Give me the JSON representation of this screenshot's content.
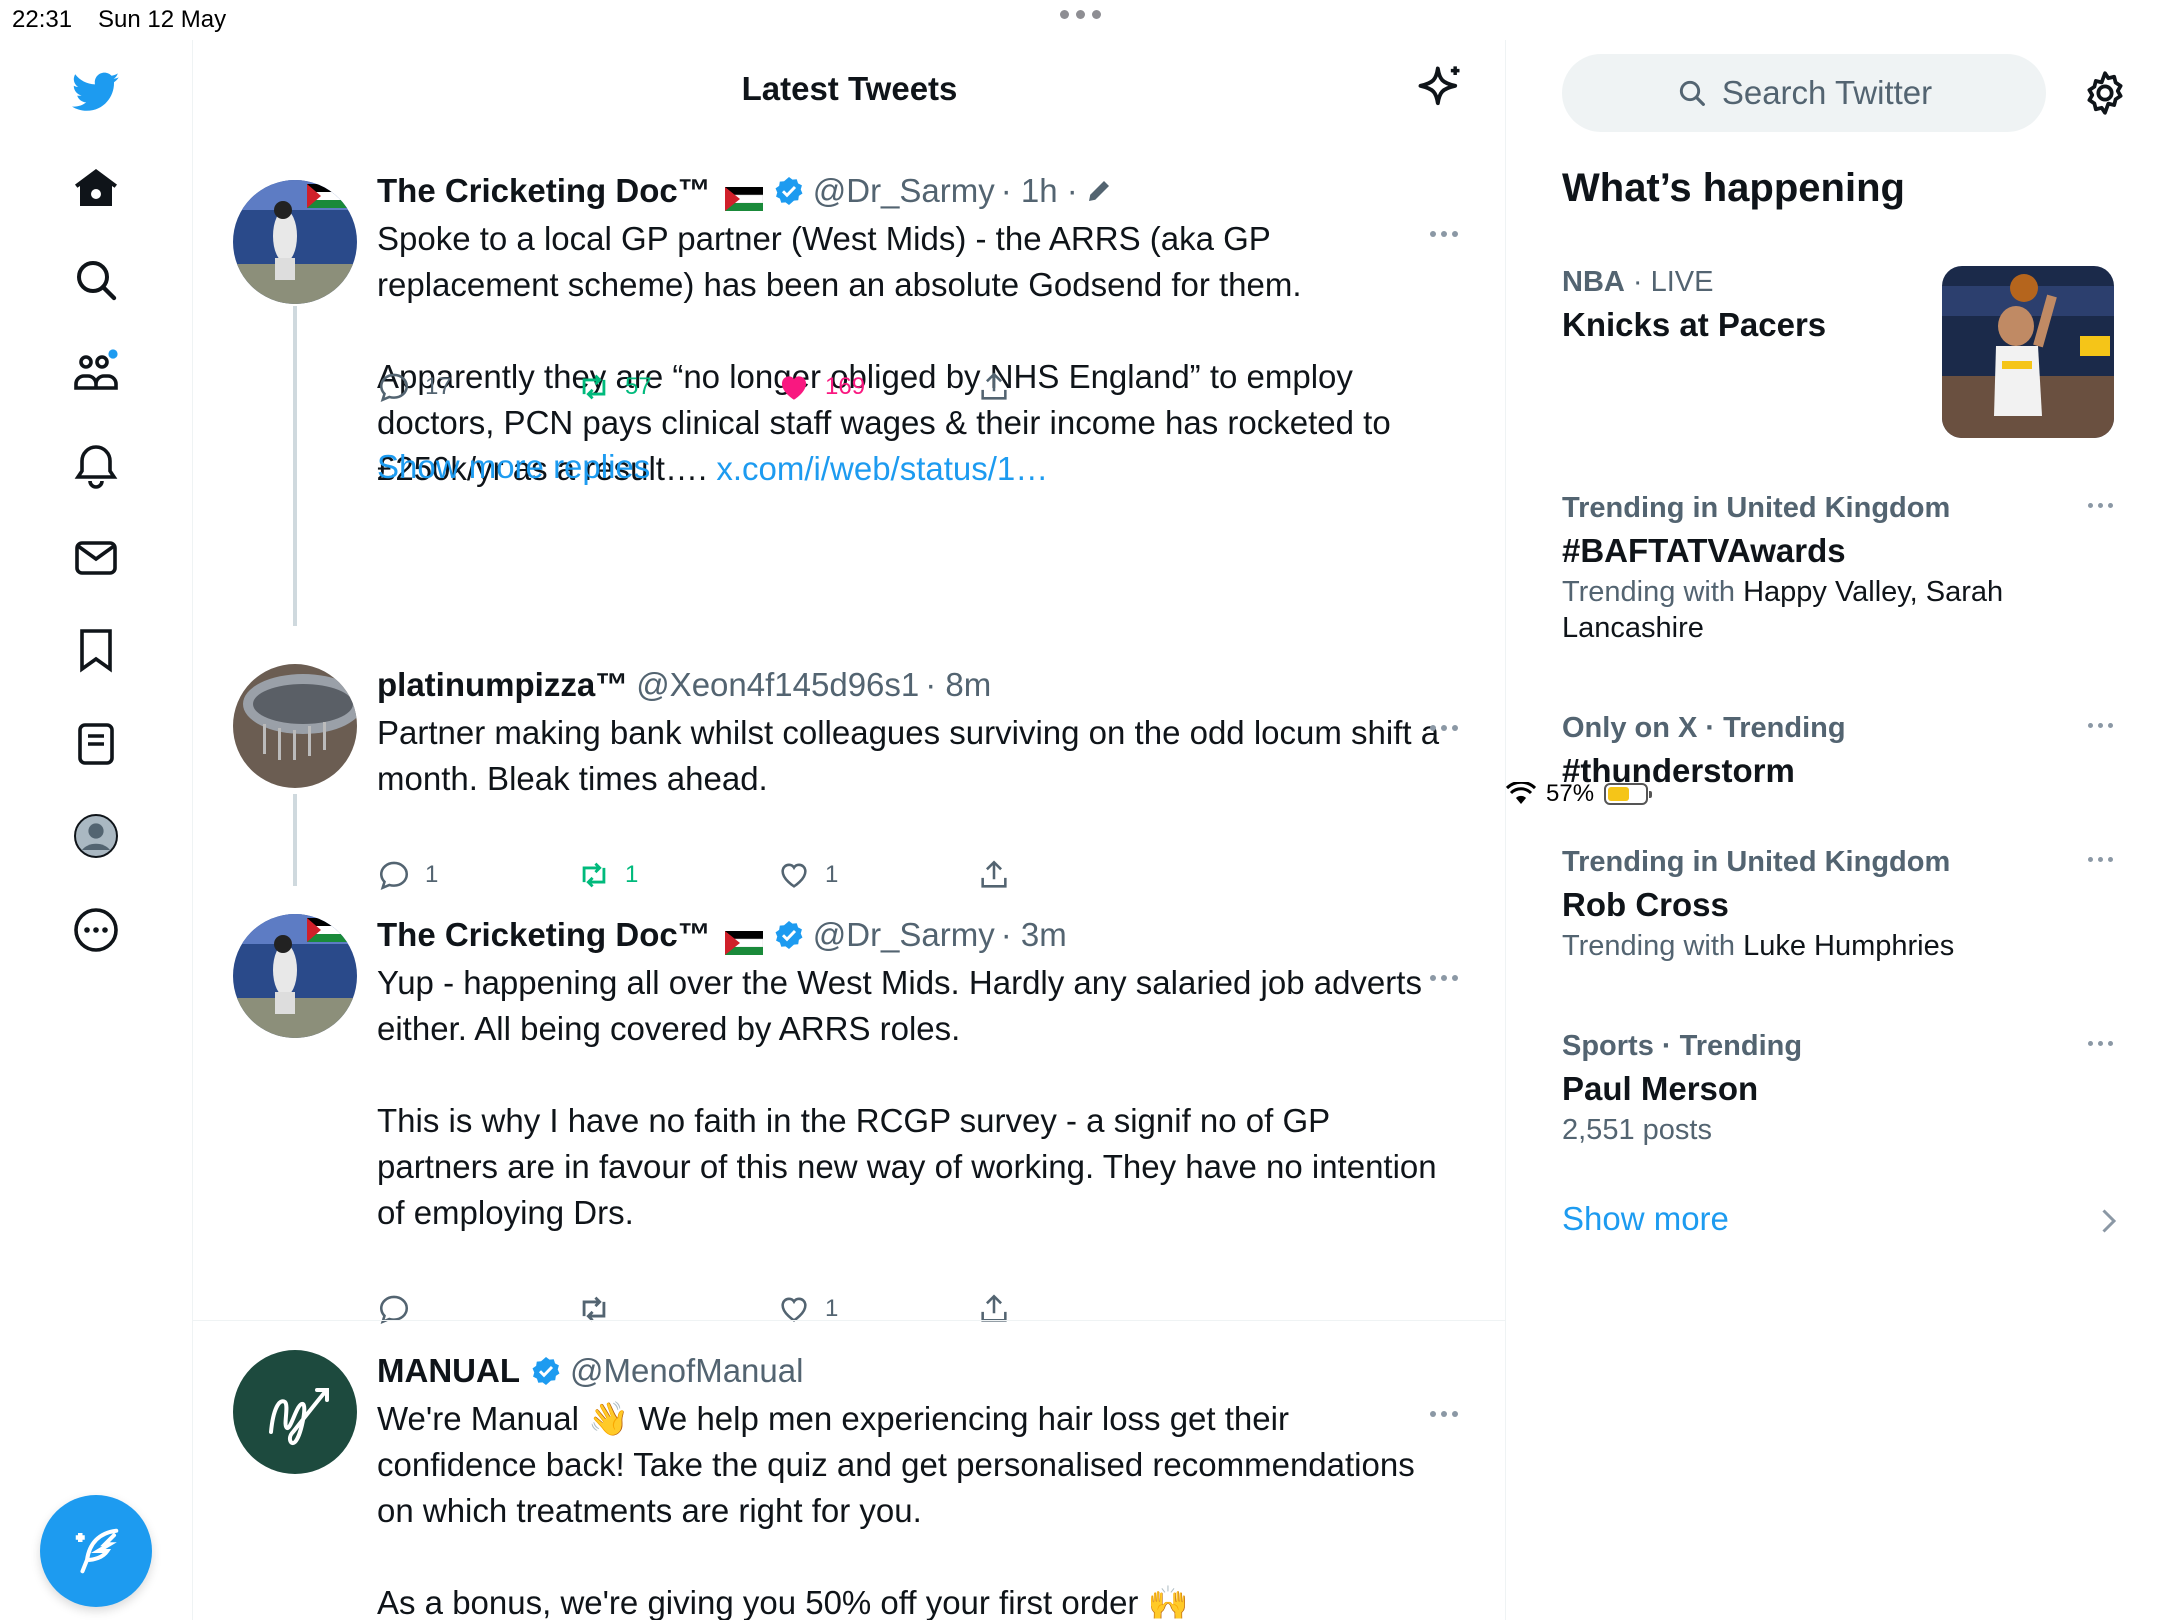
{
  "status_bar": {
    "time": "22:31",
    "date": "Sun 12 May",
    "battery": "57%",
    "battery_level": 0.57
  },
  "nav": {
    "icons": [
      "twitter-logo-icon",
      "home-icon",
      "search-icon",
      "communities-icon",
      "notifications-icon",
      "messages-icon",
      "bookmarks-icon",
      "lists-icon",
      "profile-icon",
      "more-icon"
    ],
    "compose_icon": "compose-tweet-icon"
  },
  "main": {
    "title": "Latest Tweets",
    "tweets": [
      {
        "name": "The Cricketing Doc™",
        "handle": "@Dr_Sarmy",
        "time": "· 1h ·",
        "text": "Spoke to a local GP partner (West Mids) - the ARRS (aka GP replacement scheme) has been an absolute Godsend for them.\n\nApparently they are “no longer obliged by NHS England” to employ doctors, PCN pays clinical staff wages & their income has rocketed to £250k/yr as a result…. ",
        "link": "x.com/i/web/status/1…",
        "replies": "17",
        "retweets": "57",
        "likes": "169"
      },
      {
        "name": "platinumpizza™",
        "handle": "@Xeon4f145d96s1",
        "time": "· 8m",
        "text": "Partner making bank whilst colleagues surviving on the odd locum shift a month. Bleak times ahead.",
        "replies": "1",
        "retweets": "1",
        "likes": "1"
      },
      {
        "name": "The Cricketing Doc™",
        "handle": "@Dr_Sarmy",
        "time": "· 3m",
        "text": "Yup - happening all over the West Mids. Hardly any salaried job adverts either. All being covered by ARRS roles.\n\nThis is why I have no faith in the RCGP survey - a signif no of GP partners are in favour of this new way of working. They have no intention of employing Drs.",
        "replies": "",
        "retweets": "",
        "likes": "1"
      },
      {
        "name": "MANUAL",
        "handle": "@MenofManual",
        "time": "",
        "text": "We're Manual 👋 We help men experiencing hair loss get their confidence back! Take the quiz and get personalised recommendations on which treatments are right for you.\n\nAs a bonus, we're giving you 50% off your first order 🙌"
      }
    ],
    "show_more_replies": "Show more replies"
  },
  "sidebar": {
    "search_placeholder": "Search Twitter",
    "happening_title": "What’s happening",
    "trends": [
      {
        "meta_bold": "NBA",
        "meta_rest": " · LIVE",
        "title": "Knicks at Pacers",
        "sub_label": "",
        "sub_value": ""
      },
      {
        "meta_bold": "Trending in United Kingdom",
        "meta_rest": "",
        "title": "#BAFTATVAwards",
        "sub_label": "Trending with ",
        "sub_value": "Happy Valley, Sarah Lancashire"
      },
      {
        "meta_bold": "Only on X · Trending",
        "meta_rest": "",
        "title": "#thunderstorm",
        "sub_label": "",
        "sub_value": ""
      },
      {
        "meta_bold": "Trending in United Kingdom",
        "meta_rest": "",
        "title": "Rob Cross",
        "sub_label": "Trending with ",
        "sub_value": "Luke Humphries"
      },
      {
        "meta_bold": "Sports · Trending",
        "meta_rest": "",
        "title": "Paul Merson",
        "sub_label": "2,551 posts",
        "sub_value": ""
      }
    ],
    "show_more": "Show more"
  },
  "colors": {
    "accent": "#1d9bf0",
    "retweet": "#00ba7c",
    "like": "#f91880",
    "secondary_text": "#536471"
  }
}
